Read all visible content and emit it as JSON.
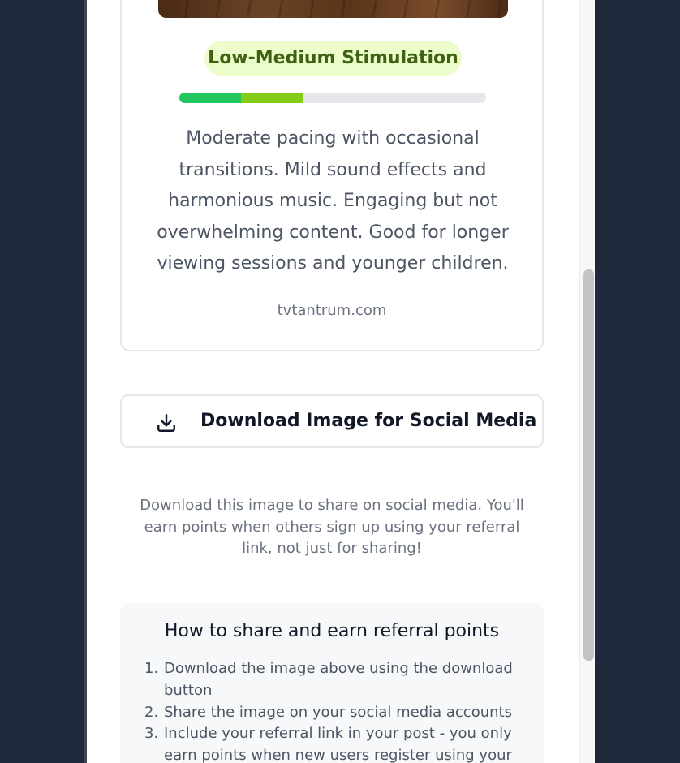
{
  "card": {
    "image_name": "show-thumbnail",
    "badge": "Low-Medium Stimulation",
    "stimulation_level": {
      "segments": [
        {
          "color": "#22c55e",
          "fraction": 0.2
        },
        {
          "color": "#84cc16",
          "fraction": 0.2
        }
      ],
      "filled_fraction": 0.4
    },
    "description": "Moderate pacing with occasional transitions. Mild sound effects and harmonious music. Engaging but not overwhelming content. Good for longer viewing sessions and younger children.",
    "source": "tvtantrum.com"
  },
  "download": {
    "icon": "download-icon",
    "label": "Download Image for Social Media"
  },
  "note": "Download this image to share on social media. You'll earn points when others sign up using your referral link, not just for sharing!",
  "howto": {
    "title": "How to share and earn referral points",
    "steps": [
      {
        "num": "1.",
        "text": "Download the image above using the download button"
      },
      {
        "num": "2.",
        "text": "Share the image on your social media accounts"
      },
      {
        "num": "3.",
        "text": "Include your referral link in your post - you only earn points when new users register using your"
      }
    ]
  },
  "colors": {
    "background": "#1e293b",
    "badge_bg": "#ecfccb",
    "badge_text": "#3f6212",
    "green": "#22c55e",
    "lime": "#84cc16"
  }
}
